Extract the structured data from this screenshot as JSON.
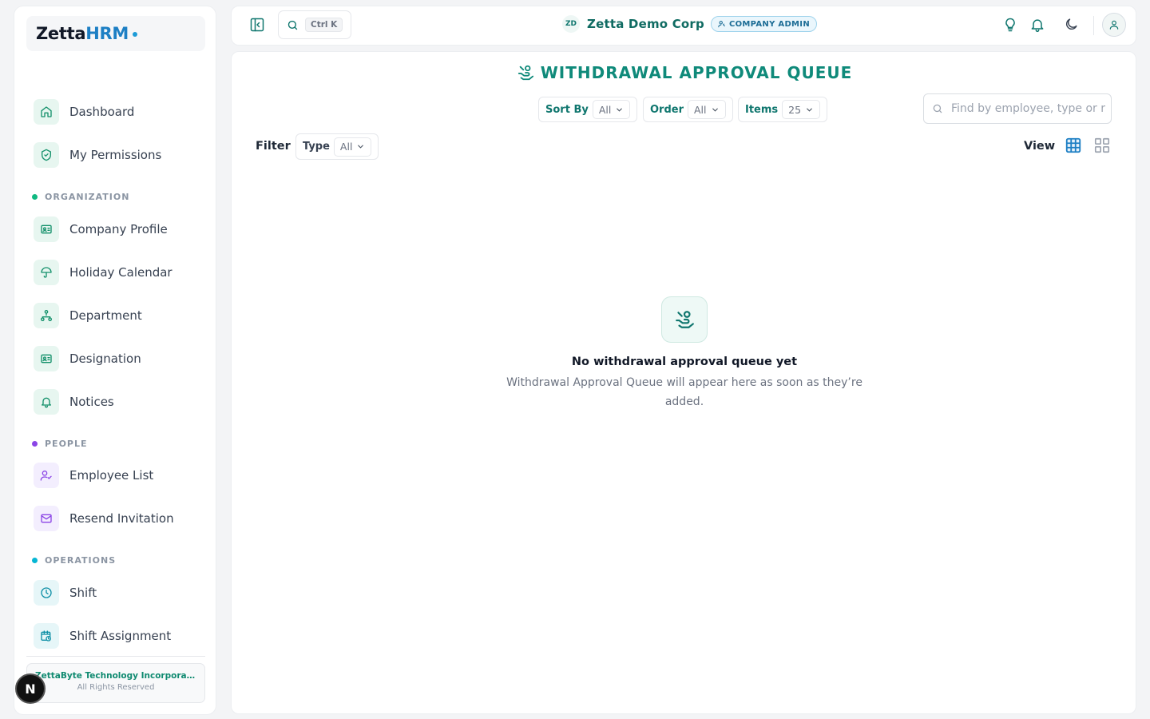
{
  "brand": {
    "part1": "Zetta",
    "part2": "HRM"
  },
  "sidebar": {
    "items": [
      {
        "label": "Dashboard",
        "icon": "home-icon"
      },
      {
        "label": "My Permissions",
        "icon": "shield-check-icon"
      }
    ],
    "sections": [
      {
        "title": "ORGANIZATION",
        "color": "#10b981",
        "items": [
          {
            "label": "Company Profile",
            "icon": "id-card-icon"
          },
          {
            "label": "Holiday Calendar",
            "icon": "umbrella-icon"
          },
          {
            "label": "Department",
            "icon": "org-chart-icon"
          },
          {
            "label": "Designation",
            "icon": "id-card-icon"
          },
          {
            "label": "Notices",
            "icon": "bell-icon"
          }
        ]
      },
      {
        "title": "PEOPLE",
        "color": "#8b45e6",
        "items": [
          {
            "label": "Employee List",
            "icon": "user-check-icon"
          },
          {
            "label": "Resend Invitation",
            "icon": "mail-icon"
          }
        ]
      },
      {
        "title": "OPERATIONS",
        "color": "#06b6d4",
        "items": [
          {
            "label": "Shift",
            "icon": "clock-icon"
          },
          {
            "label": "Shift Assignment",
            "icon": "calendar-clock-icon"
          }
        ]
      }
    ],
    "footer": {
      "company": "ZettaByte Technology Incorporated",
      "rights": "All Rights Reserved"
    }
  },
  "dev_badge": "N",
  "topbar": {
    "search_shortcut": "Ctrl K",
    "company_initials": "ZD",
    "company_name": "Zetta Demo Corp",
    "role": "COMPANY ADMIN"
  },
  "page": {
    "title": "WITHDRAWAL APPROVAL QUEUE",
    "controls": {
      "sort_by": {
        "label": "Sort By",
        "value": "All"
      },
      "order": {
        "label": "Order",
        "value": "All"
      },
      "items": {
        "label": "Items",
        "value": "25"
      }
    },
    "search_placeholder": "Find by employee, type or r",
    "filter": {
      "label": "Filter",
      "type_label": "Type",
      "type_value": "All"
    },
    "view_label": "View",
    "empty": {
      "title": "No withdrawal approval queue yet",
      "description": "Withdrawal Approval Queue will appear here as soon as they’re added."
    }
  },
  "colors": {
    "accent": "#0f8a7a",
    "brand_blue": "#1d7fc4"
  }
}
